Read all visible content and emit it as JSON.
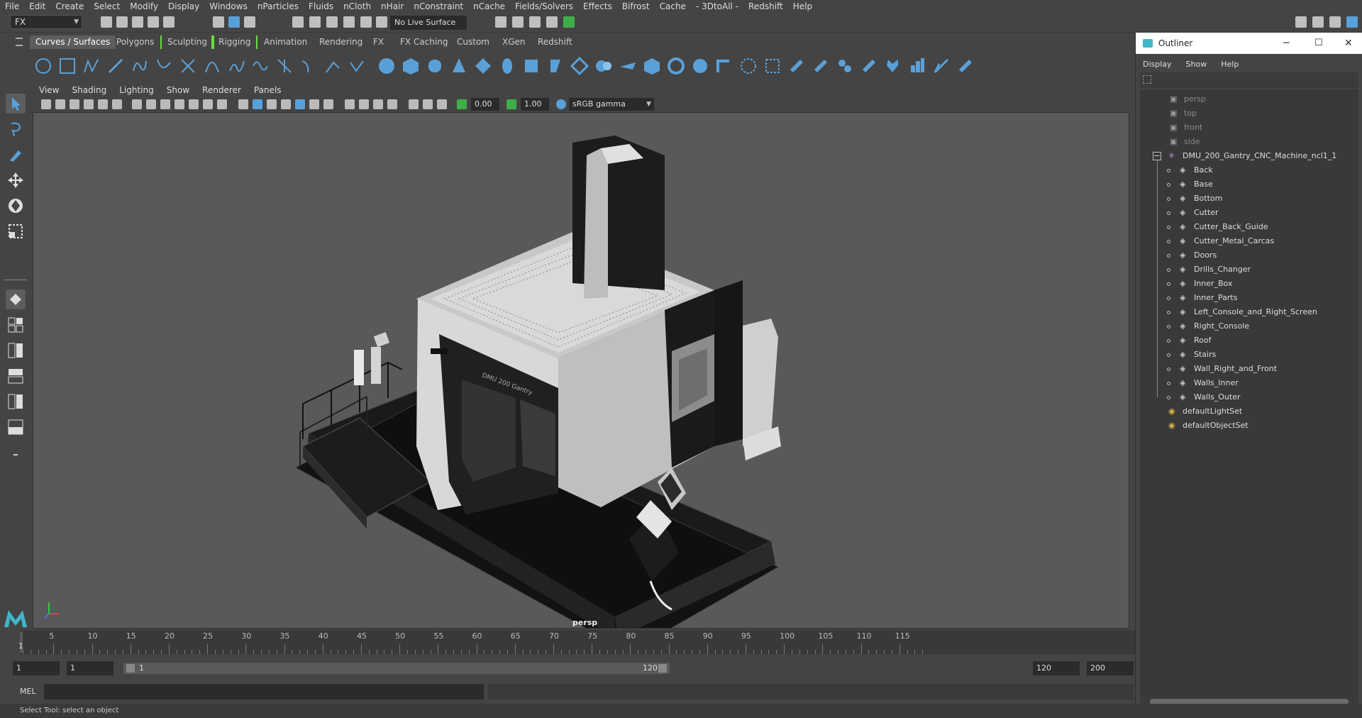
{
  "menubar": {
    "items": [
      "File",
      "Edit",
      "Create",
      "Select",
      "Modify",
      "Display",
      "Windows",
      "nParticles",
      "Fluids",
      "nCloth",
      "nHair",
      "nConstraint",
      "nCache",
      "Fields/Solvers",
      "Effects",
      "Bifrost",
      "Cache",
      "- 3DtoAll -",
      "Redshift",
      "Help"
    ]
  },
  "statusline": {
    "mode": "FX",
    "live_surface": "No Live Surface"
  },
  "shelf": {
    "tabs": [
      "Curves / Surfaces",
      "Polygons",
      "Sculpting",
      "Rigging",
      "Animation",
      "Rendering",
      "FX",
      "FX Caching",
      "Custom",
      "XGen",
      "Redshift"
    ],
    "active_tab": "Curves / Surfaces",
    "accent_color": "#5aa0d8"
  },
  "viewport": {
    "menu": [
      "View",
      "Shading",
      "Lighting",
      "Show",
      "Renderer",
      "Panels"
    ],
    "exposure": "0.00",
    "gamma": "1.00",
    "color_space": "sRGB gamma",
    "camera_label": "persp",
    "machine_label": "DMU 200 Gantry"
  },
  "outliner": {
    "title": "Outliner",
    "menu": [
      "Display",
      "Show",
      "Help"
    ],
    "cameras": [
      "persp",
      "top",
      "front",
      "side"
    ],
    "root": "DMU_200_Gantry_CNC_Machine_ncl1_1",
    "children": [
      "Back",
      "Base",
      "Bottom",
      "Cutter",
      "Cutter_Back_Guide",
      "Cutter_Metal_Carcas",
      "Doors",
      "Drills_Changer",
      "Inner_Box",
      "Inner_Parts",
      "Left_Console_and_Right_Screen",
      "Right_Console",
      "Roof",
      "Stairs",
      "Wall_Right_and_Front",
      "Walls_Inner",
      "Walls_Outer"
    ],
    "sets": [
      "defaultLightSet",
      "defaultObjectSet"
    ]
  },
  "timeline": {
    "current_frame": "1",
    "ticks": [
      "5",
      "10",
      "15",
      "20",
      "25",
      "30",
      "35",
      "40",
      "45",
      "50",
      "55",
      "60",
      "65",
      "70",
      "75",
      "80",
      "85",
      "90",
      "95",
      "100",
      "105",
      "110",
      "115"
    ],
    "range_start": "1",
    "range_start_inner": "1",
    "range_slider_start": "1",
    "range_slider_end": "120",
    "range_end": "120",
    "anim_end": "200"
  },
  "commandline": {
    "label": "MEL"
  },
  "helpline": {
    "text": "Select Tool: select an object"
  }
}
